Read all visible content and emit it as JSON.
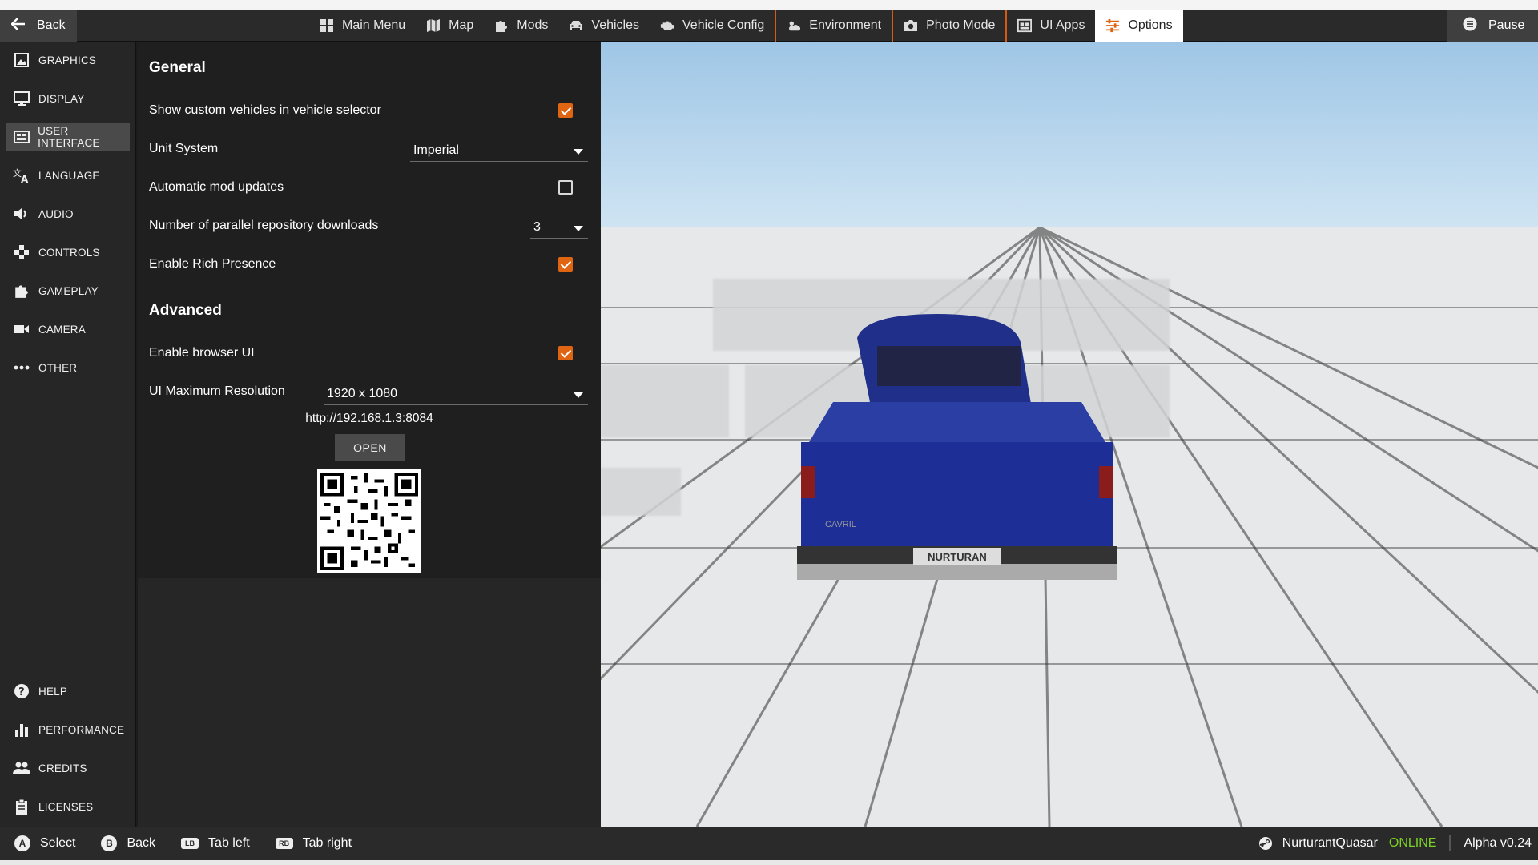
{
  "topbar": {
    "back_label": "Back",
    "pause_label": "Pause",
    "nav": [
      {
        "label": "Main Menu",
        "icon": "grid-icon"
      },
      {
        "label": "Map",
        "icon": "map-icon"
      },
      {
        "label": "Mods",
        "icon": "puzzle-icon"
      },
      {
        "label": "Vehicles",
        "icon": "car-icon"
      },
      {
        "label": "Vehicle Config",
        "icon": "engine-icon"
      },
      {
        "label": "Environment",
        "icon": "weather-icon"
      },
      {
        "label": "Photo Mode",
        "icon": "camera-icon"
      },
      {
        "label": "UI Apps",
        "icon": "apps-icon"
      },
      {
        "label": "Options",
        "icon": "sliders-icon",
        "active": true
      }
    ]
  },
  "sidebar": {
    "items": [
      {
        "label": "GRAPHICS",
        "icon": "image-icon"
      },
      {
        "label": "DISPLAY",
        "icon": "monitor-icon"
      },
      {
        "label": "USER INTERFACE",
        "icon": "ui-icon",
        "active": true
      },
      {
        "label": "LANGUAGE",
        "icon": "translate-icon"
      },
      {
        "label": "AUDIO",
        "icon": "speaker-icon"
      },
      {
        "label": "CONTROLS",
        "icon": "gamepad-icon"
      },
      {
        "label": "GAMEPLAY",
        "icon": "puzzle-icon"
      },
      {
        "label": "CAMERA",
        "icon": "videocam-icon"
      },
      {
        "label": "OTHER",
        "icon": "more-icon"
      }
    ],
    "bottom_items": [
      {
        "label": "HELP",
        "icon": "help-icon"
      },
      {
        "label": "PERFORMANCE",
        "icon": "bar-chart-icon"
      },
      {
        "label": "CREDITS",
        "icon": "people-icon"
      },
      {
        "label": "LICENSES",
        "icon": "clipboard-icon"
      }
    ]
  },
  "general": {
    "title": "General",
    "show_custom_vehicles": {
      "label": "Show custom vehicles in vehicle selector",
      "checked": true
    },
    "unit_system": {
      "label": "Unit System",
      "value": "Imperial"
    },
    "auto_mod_updates": {
      "label": "Automatic mod updates",
      "checked": false
    },
    "parallel_downloads": {
      "label": "Number of parallel repository downloads",
      "value": "3"
    },
    "rich_presence": {
      "label": "Enable Rich Presence",
      "checked": true
    }
  },
  "advanced": {
    "title": "Advanced",
    "browser_ui": {
      "label": "Enable browser UI",
      "checked": true
    },
    "max_resolution": {
      "label": "UI Maximum Resolution",
      "value": "1920 x 1080"
    },
    "url": "http://192.168.1.3:8084",
    "open_label": "OPEN"
  },
  "scene": {
    "license_plate": "NURTURAN",
    "tailgate_text": "CAVRIL"
  },
  "bottombar": {
    "hints": [
      {
        "key": "A",
        "label": "Select"
      },
      {
        "key": "B",
        "label": "Back"
      },
      {
        "key": "LB",
        "label": "Tab left"
      },
      {
        "key": "RB",
        "label": "Tab right"
      }
    ],
    "username": "NurturantQuasar",
    "status": "ONLINE",
    "version": "Alpha v0.24"
  },
  "colors": {
    "accent": "#e06512",
    "online": "#7cd224",
    "panel": "#262626"
  }
}
